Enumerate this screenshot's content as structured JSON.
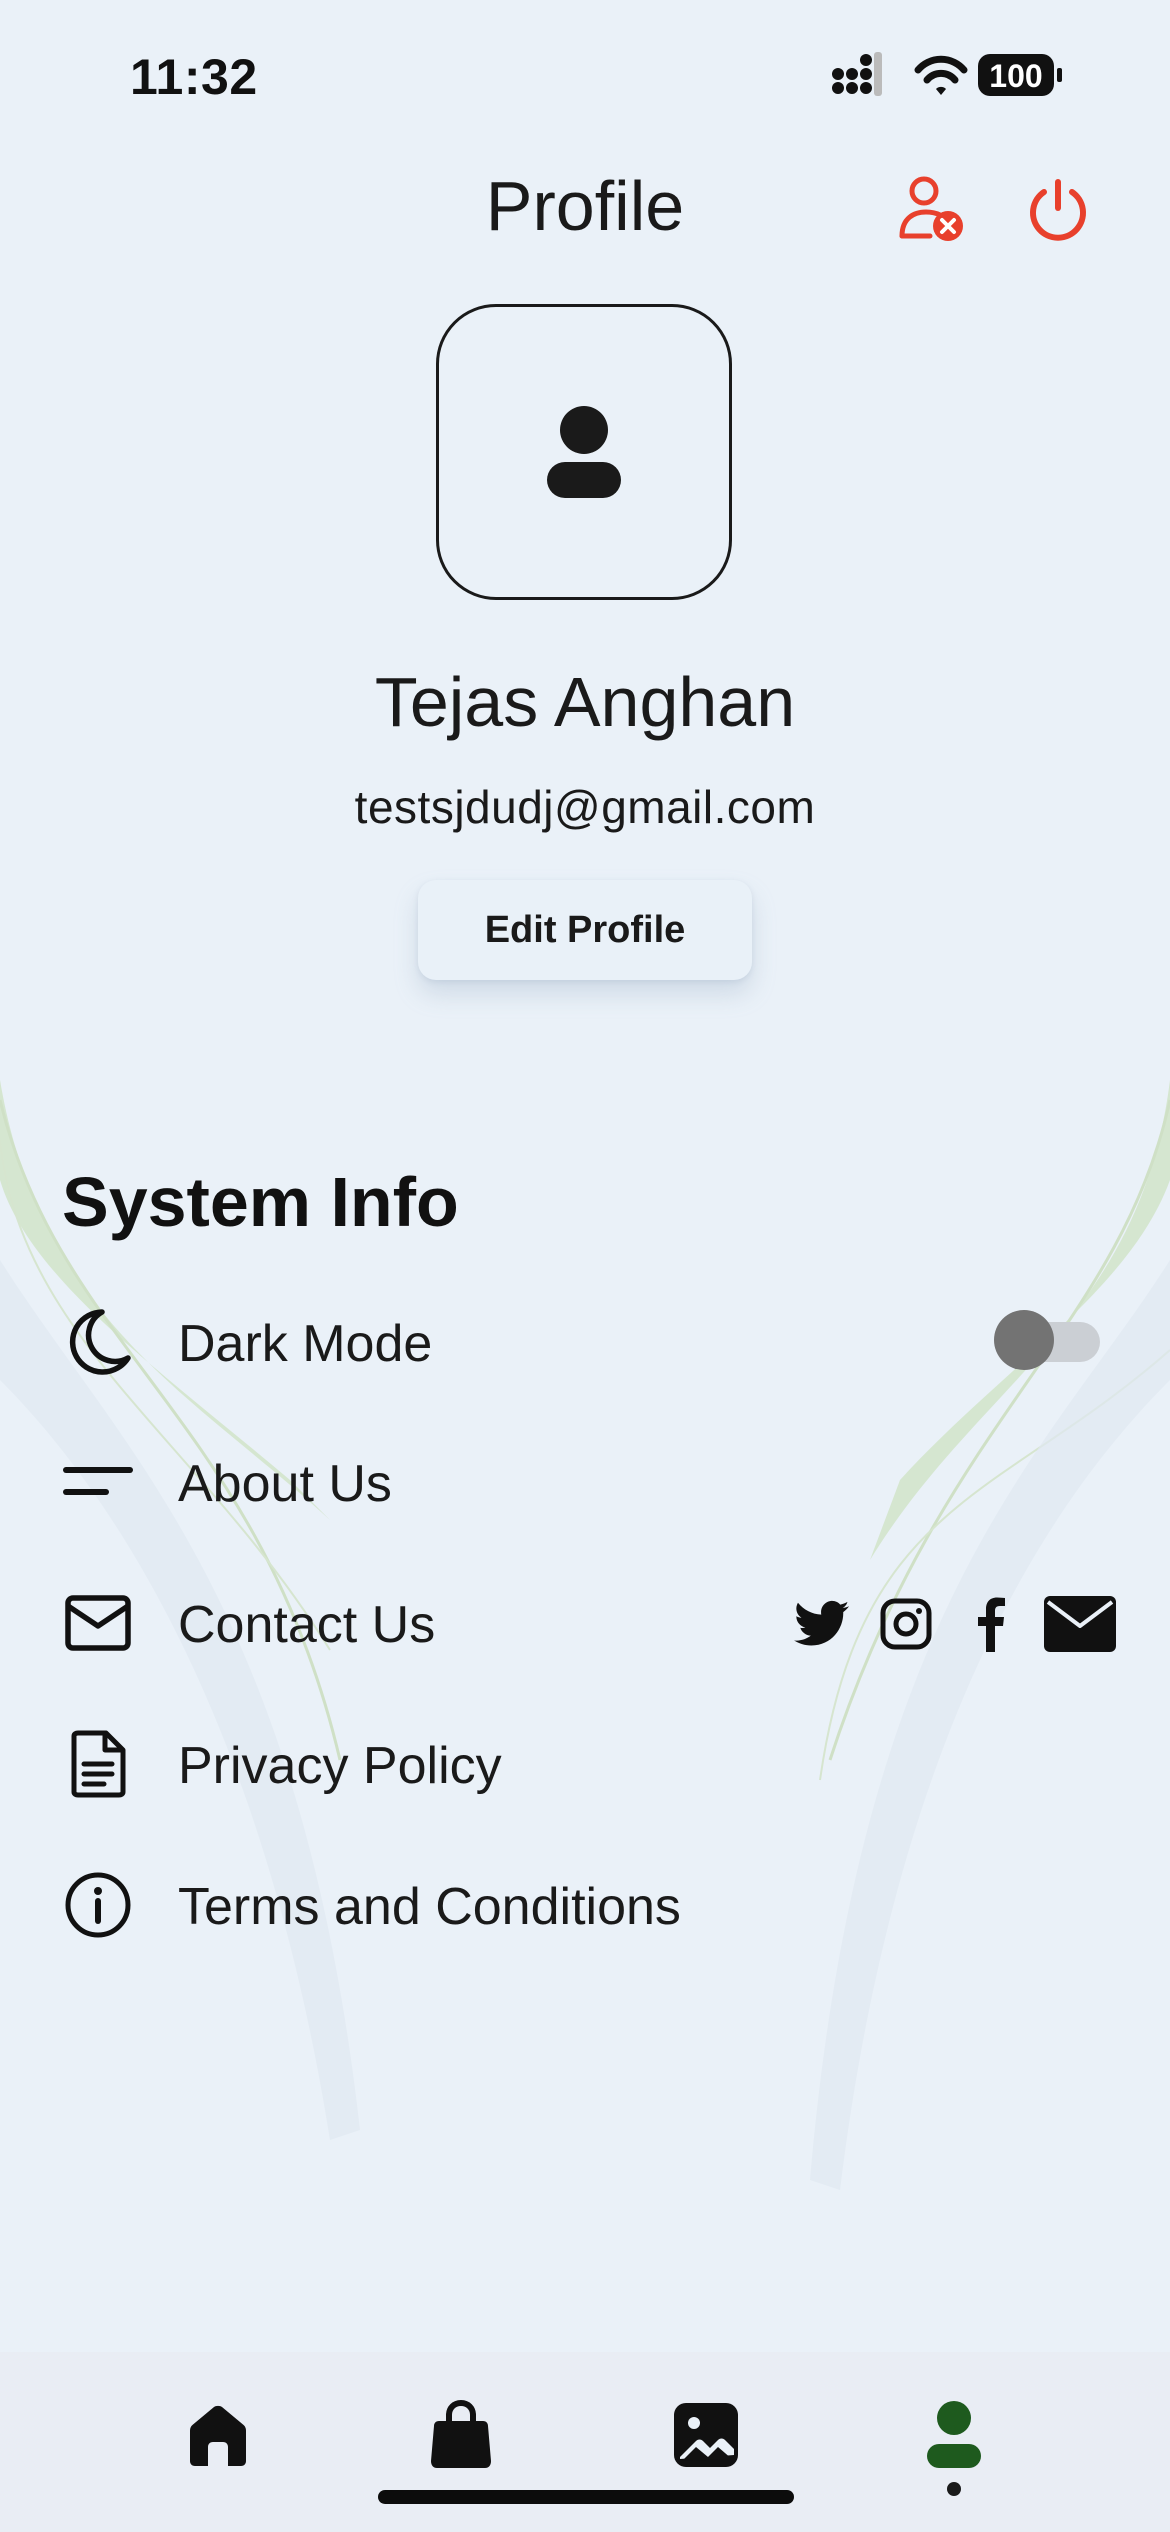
{
  "status": {
    "time": "11:32",
    "battery": "100"
  },
  "header": {
    "title": "Profile",
    "delete_icon": "user-remove-icon",
    "logout_icon": "power-icon",
    "accent": "#e8402c"
  },
  "profile": {
    "name": "Tejas Anghan",
    "email": "testsjdudj@gmail.com",
    "edit_label": "Edit Profile",
    "avatar_icon": "person-icon"
  },
  "system": {
    "title": "System Info",
    "dark_mode": {
      "label": "Dark Mode",
      "icon": "moon-icon",
      "enabled": false
    },
    "items": [
      {
        "label": "About Us",
        "icon": "menu-lines-icon"
      },
      {
        "label": "Contact Us",
        "icon": "envelope-icon"
      },
      {
        "label": "Privacy Policy",
        "icon": "document-icon"
      },
      {
        "label": "Terms and Conditions",
        "icon": "info-icon"
      }
    ],
    "social": [
      "twitter-icon",
      "instagram-icon",
      "facebook-icon",
      "mail-icon"
    ]
  },
  "nav": {
    "items": [
      "home-icon",
      "bag-icon",
      "gallery-icon",
      "profile-icon"
    ],
    "active": "profile",
    "active_color": "#1e5a1e"
  }
}
